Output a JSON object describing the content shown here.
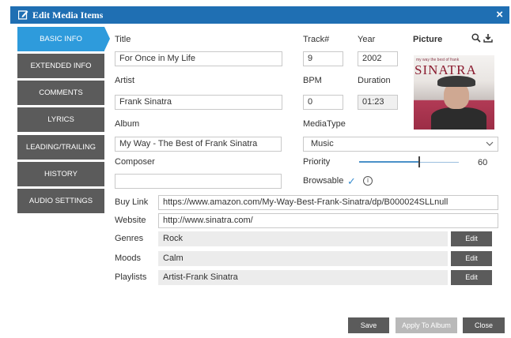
{
  "window": {
    "title": "Edit Media Items"
  },
  "sidebar": {
    "items": [
      {
        "label": "BASIC INFO",
        "active": true
      },
      {
        "label": "EXTENDED INFO"
      },
      {
        "label": "COMMENTS"
      },
      {
        "label": "LYRICS"
      },
      {
        "label": "LEADING/TRAILING"
      },
      {
        "label": "HISTORY"
      },
      {
        "label": "AUDIO SETTINGS"
      }
    ]
  },
  "form": {
    "title": {
      "label": "Title",
      "value": "For Once in My Life"
    },
    "track": {
      "label": "Track#",
      "value": "9"
    },
    "year": {
      "label": "Year",
      "value": "2002"
    },
    "artist": {
      "label": "Artist",
      "value": "Frank Sinatra"
    },
    "bpm": {
      "label": "BPM",
      "value": "0"
    },
    "duration": {
      "label": "Duration",
      "value": "01:23"
    },
    "album": {
      "label": "Album",
      "value": "My Way - The Best of Frank Sinatra"
    },
    "media_type": {
      "label": "MediaType",
      "value": "Music"
    },
    "composer": {
      "label": "Composer",
      "value": ""
    },
    "priority": {
      "label": "Priority",
      "value": 60,
      "max": 100
    },
    "browsable": {
      "label": "Browsable",
      "checked": true
    },
    "buy_link": {
      "label": "Buy Link",
      "value": "https://www.amazon.com/My-Way-Best-Frank-Sinatra/dp/B000024SLLnull"
    },
    "website": {
      "label": "Website",
      "value": "http://www.sinatra.com/"
    },
    "genres": {
      "label": "Genres",
      "value": "Rock",
      "edit_label": "Edit"
    },
    "moods": {
      "label": "Moods",
      "value": "Calm",
      "edit_label": "Edit"
    },
    "playlists": {
      "label": "Playlists",
      "value": "Artist-Frank Sinatra",
      "edit_label": "Edit"
    }
  },
  "picture": {
    "label": "Picture",
    "search_icon": "search-icon",
    "download_icon": "download-icon",
    "cover_small_text": "my way the best of frank",
    "cover_artist_text": "SINATRA"
  },
  "footer": {
    "save_label": "Save",
    "apply_label": "Apply To Album",
    "close_label": "Close"
  },
  "colors": {
    "titlebar": "#1f6fb3",
    "sidebar_active": "#2e9bdc",
    "sidebar_item": "#5b5b5b",
    "button_dark": "#5b5b5b",
    "button_disabled": "#b9b9b9"
  }
}
